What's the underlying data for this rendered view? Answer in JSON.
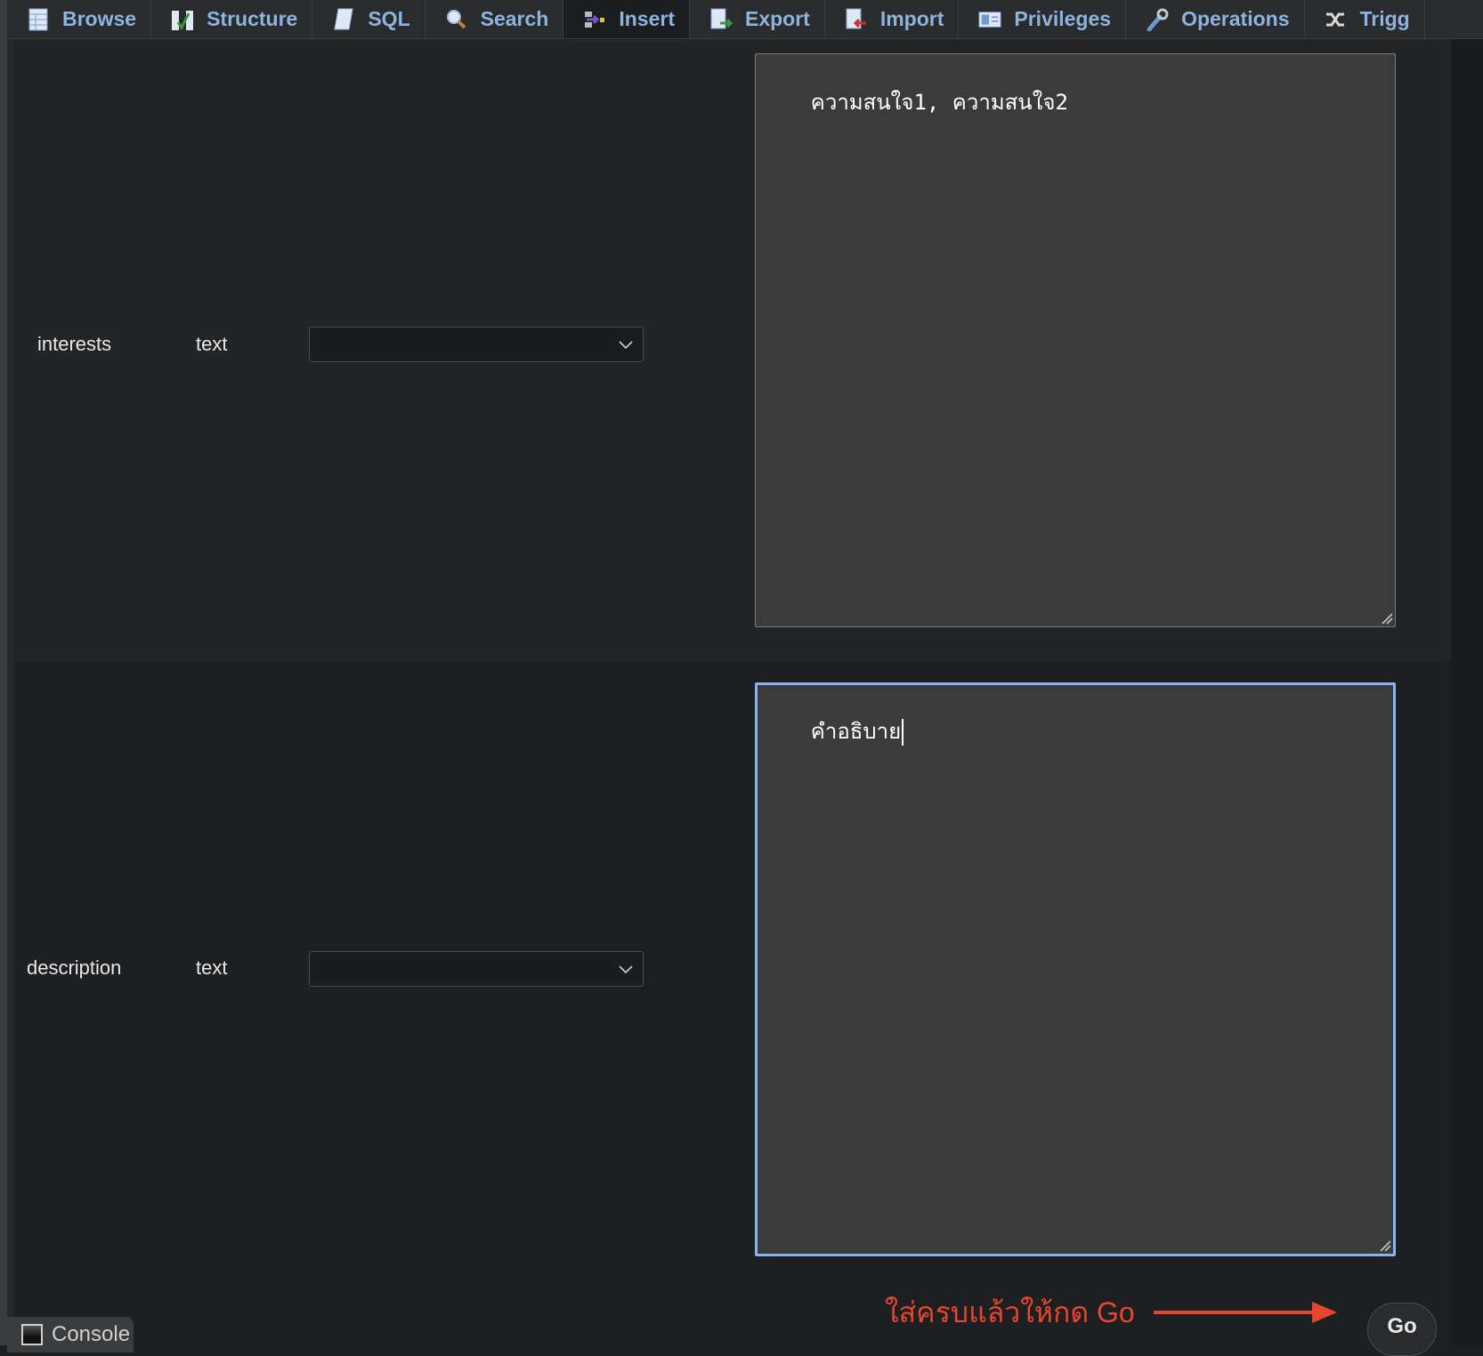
{
  "tabs": [
    {
      "label": "Browse",
      "icon": "table-icon",
      "active": false
    },
    {
      "label": "Structure",
      "icon": "structure-icon",
      "active": false
    },
    {
      "label": "SQL",
      "icon": "sql-icon",
      "active": false
    },
    {
      "label": "Search",
      "icon": "search-icon",
      "active": false
    },
    {
      "label": "Insert",
      "icon": "insert-icon",
      "active": true
    },
    {
      "label": "Export",
      "icon": "export-icon",
      "active": false
    },
    {
      "label": "Import",
      "icon": "import-icon",
      "active": false
    },
    {
      "label": "Privileges",
      "icon": "privileges-icon",
      "active": false
    },
    {
      "label": "Operations",
      "icon": "wrench-icon",
      "active": false
    },
    {
      "label": "Trigg",
      "icon": "triggers-icon",
      "active": false
    }
  ],
  "fields": [
    {
      "name": "interests",
      "type": "text",
      "function": "",
      "value": "ความสนใจ1, ความสนใจ2"
    },
    {
      "name": "description",
      "type": "text",
      "function": "",
      "value": "คำอธิบาย"
    }
  ],
  "annotation": {
    "text": "ใส่ครบแล้วให้กด Go",
    "color": "#e8452f"
  },
  "go_label": "Go",
  "console_label": "Console",
  "colors": {
    "tab_text": "#8db4e0",
    "focus_border": "#8ab4f0"
  }
}
